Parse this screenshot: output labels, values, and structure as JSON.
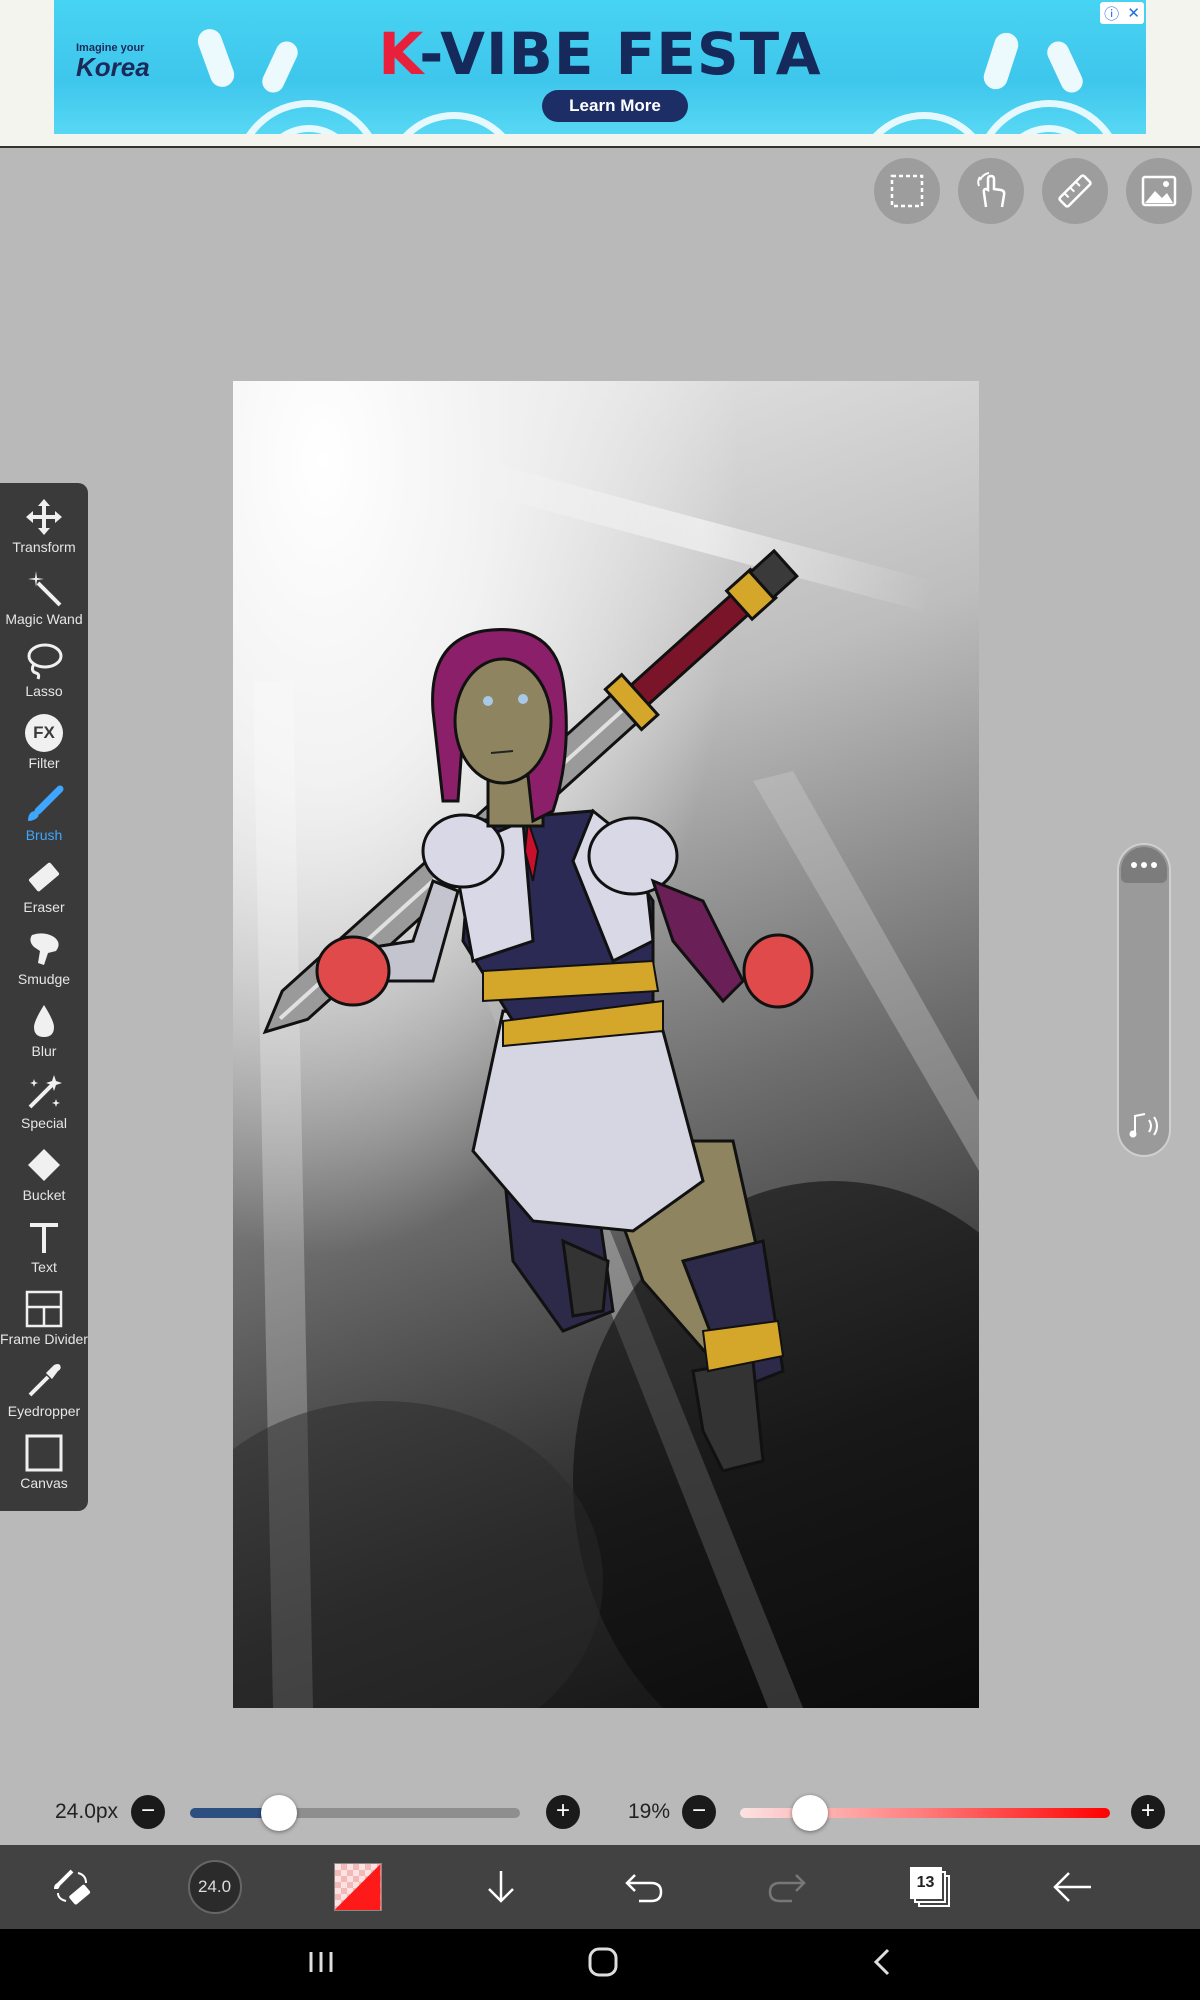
{
  "ad": {
    "brand_line1": "Imagine your",
    "brand_line2": "Korea",
    "title_k": "K",
    "title_rest": "-VIBE FESTA",
    "cta": "Learn More",
    "info_icon": "info-icon",
    "close_icon": "close-icon"
  },
  "top_tools": [
    {
      "name": "selection-icon"
    },
    {
      "name": "gesture-icon"
    },
    {
      "name": "ruler-icon"
    },
    {
      "name": "reference-image-icon"
    }
  ],
  "tools": [
    {
      "label": "Transform",
      "icon": "move-icon",
      "active": false
    },
    {
      "label": "Magic Wand",
      "icon": "magic-wand-icon",
      "active": false
    },
    {
      "label": "Lasso",
      "icon": "lasso-icon",
      "active": false
    },
    {
      "label": "Filter",
      "icon": "fx-icon",
      "active": false
    },
    {
      "label": "Brush",
      "icon": "brush-icon",
      "active": true
    },
    {
      "label": "Eraser",
      "icon": "eraser-icon",
      "active": false
    },
    {
      "label": "Smudge",
      "icon": "smudge-icon",
      "active": false
    },
    {
      "label": "Blur",
      "icon": "drop-icon",
      "active": false
    },
    {
      "label": "Special",
      "icon": "sparkle-icon",
      "active": false
    },
    {
      "label": "Bucket",
      "icon": "bucket-icon",
      "active": false
    },
    {
      "label": "Text",
      "icon": "text-icon",
      "active": false
    },
    {
      "label": "Frame Divider",
      "icon": "frame-divider-icon",
      "active": false
    },
    {
      "label": "Eyedropper",
      "icon": "eyedropper-icon",
      "active": false
    },
    {
      "label": "Canvas",
      "icon": "canvas-icon",
      "active": false
    }
  ],
  "fx_text": "FX",
  "sliders": {
    "size": {
      "label": "24.0px",
      "value": 0.27
    },
    "opacity": {
      "label": "19%",
      "value": 0.19
    }
  },
  "bottom_bar": {
    "brush_size": "24.0",
    "layer_count": "13",
    "color": "#ff1a1a"
  },
  "colors": {
    "accent": "#3ea6ff",
    "size_track": "#2c4f80",
    "opacity_track": "#ff0000"
  }
}
